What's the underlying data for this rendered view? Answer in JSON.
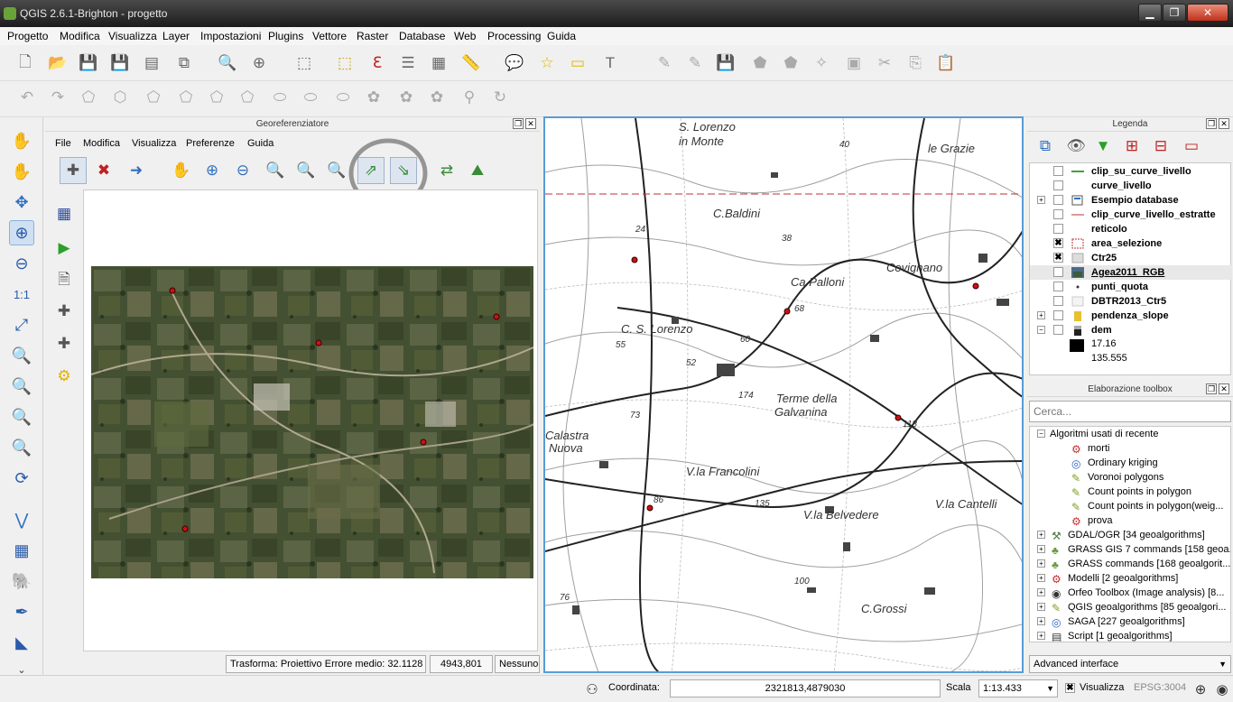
{
  "window": {
    "title": "QGIS 2.6.1-Brighton - progetto",
    "minimize": "▁",
    "maximize": "❐",
    "close": "✕"
  },
  "menu": [
    "Progetto",
    "Modifica",
    "Visualizza",
    "Layer",
    "Impostazioni",
    "Plugins",
    "Vettore",
    "Raster",
    "Database",
    "Web",
    "Processing",
    "Guida"
  ],
  "georef": {
    "title": "Georeferenziatore",
    "menu": [
      "File",
      "Modifica",
      "Visualizza",
      "Preferenze",
      "Guida"
    ],
    "status": {
      "transform": "Trasforma: Proiettivo Errore medio: 32.1128",
      "coords": "4943,801",
      "crs": "Nessuno"
    }
  },
  "map": {
    "labels": [
      "S. Lorenzo",
      "in Monte",
      "le Grazie",
      "C.Baldini",
      "Covignano",
      "Ca Palloni",
      "C. S. Lorenzo",
      "Terme della",
      "Galvanina",
      "Calastra",
      "Nuova",
      "V.la Francolini",
      "V.la Belvedere",
      "V.la Cantelli",
      "C.Grossi"
    ],
    "spot_heights": [
      "24",
      "38",
      "55",
      "52",
      "60",
      "73",
      "174",
      "86",
      "135",
      "76",
      "100",
      "118",
      "68",
      "40"
    ]
  },
  "legend": {
    "title": "Legenda",
    "layers": [
      {
        "name": "clip_su_curve_livello",
        "checked": false,
        "expand": false,
        "symbol": "green-line"
      },
      {
        "name": "curve_livello",
        "checked": false,
        "expand": false,
        "symbol": "none"
      },
      {
        "name": "Esempio database",
        "checked": false,
        "expand": true,
        "symbol": "db"
      },
      {
        "name": "clip_curve_livello_estratte",
        "checked": false,
        "expand": false,
        "symbol": "red-line"
      },
      {
        "name": "reticolo",
        "checked": false,
        "expand": false,
        "symbol": "none"
      },
      {
        "name": "area_selezione",
        "checked": true,
        "expand": false,
        "symbol": "red-dashed-box"
      },
      {
        "name": "Ctr25",
        "checked": true,
        "expand": false,
        "symbol": "raster-gray"
      },
      {
        "name": "Agea2011_RGB",
        "checked": false,
        "expand": false,
        "symbol": "raster-photo"
      },
      {
        "name": "punti_quota",
        "checked": false,
        "expand": false,
        "symbol": "dot"
      },
      {
        "name": "DBTR2013_Ctr5",
        "checked": false,
        "expand": false,
        "symbol": "raster-light"
      },
      {
        "name": "pendenza_slope",
        "checked": false,
        "expand": true,
        "symbol": "yellow"
      },
      {
        "name": "dem",
        "checked": false,
        "expand": true,
        "symbol": "dem"
      }
    ],
    "dem_max": "17.16",
    "dem_min": "135.555"
  },
  "toolbox": {
    "title": "Elaborazione toolbox",
    "search_placeholder": "Cerca...",
    "recent_group": "Algoritmi usati di recente",
    "recent": [
      {
        "name": "morti",
        "icon": "gear-red"
      },
      {
        "name": "Ordinary kriging",
        "icon": "saga-blue"
      },
      {
        "name": "Voronoi polygons",
        "icon": "qgis-green"
      },
      {
        "name": "Count points in polygon",
        "icon": "qgis-green"
      },
      {
        "name": "Count points in polygon(weig...",
        "icon": "qgis-green"
      },
      {
        "name": "prova",
        "icon": "gear-red"
      }
    ],
    "providers": [
      {
        "name": "GDAL/OGR [34 geoalgorithms]",
        "icon": "gdal"
      },
      {
        "name": "GRASS GIS 7 commands [158 geoa...",
        "icon": "grass"
      },
      {
        "name": "GRASS commands [168 geoalgorit...",
        "icon": "grass"
      },
      {
        "name": "Modelli [2 geoalgorithms]",
        "icon": "gear-red"
      },
      {
        "name": "Orfeo Toolbox (Image analysis) [8...",
        "icon": "otb"
      },
      {
        "name": "QGIS geoalgorithms [85 geoalgori...",
        "icon": "qgis-green"
      },
      {
        "name": "SAGA [227 geoalgorithms]",
        "icon": "saga-blue"
      },
      {
        "name": "Script [1 geoalgorithms]",
        "icon": "script"
      }
    ],
    "advanced": "Advanced interface"
  },
  "status": {
    "coord_label": "Coordinata:",
    "coord_value": "2321813,4879030",
    "scale_label": "Scala",
    "scale_value": "1:13.433",
    "render_label": "Visualizza",
    "crs": "EPSG:3004"
  },
  "colors": {
    "accent": "#5b9bd5",
    "gcp": "#d01010",
    "titlebar": "#2a2a2a"
  }
}
